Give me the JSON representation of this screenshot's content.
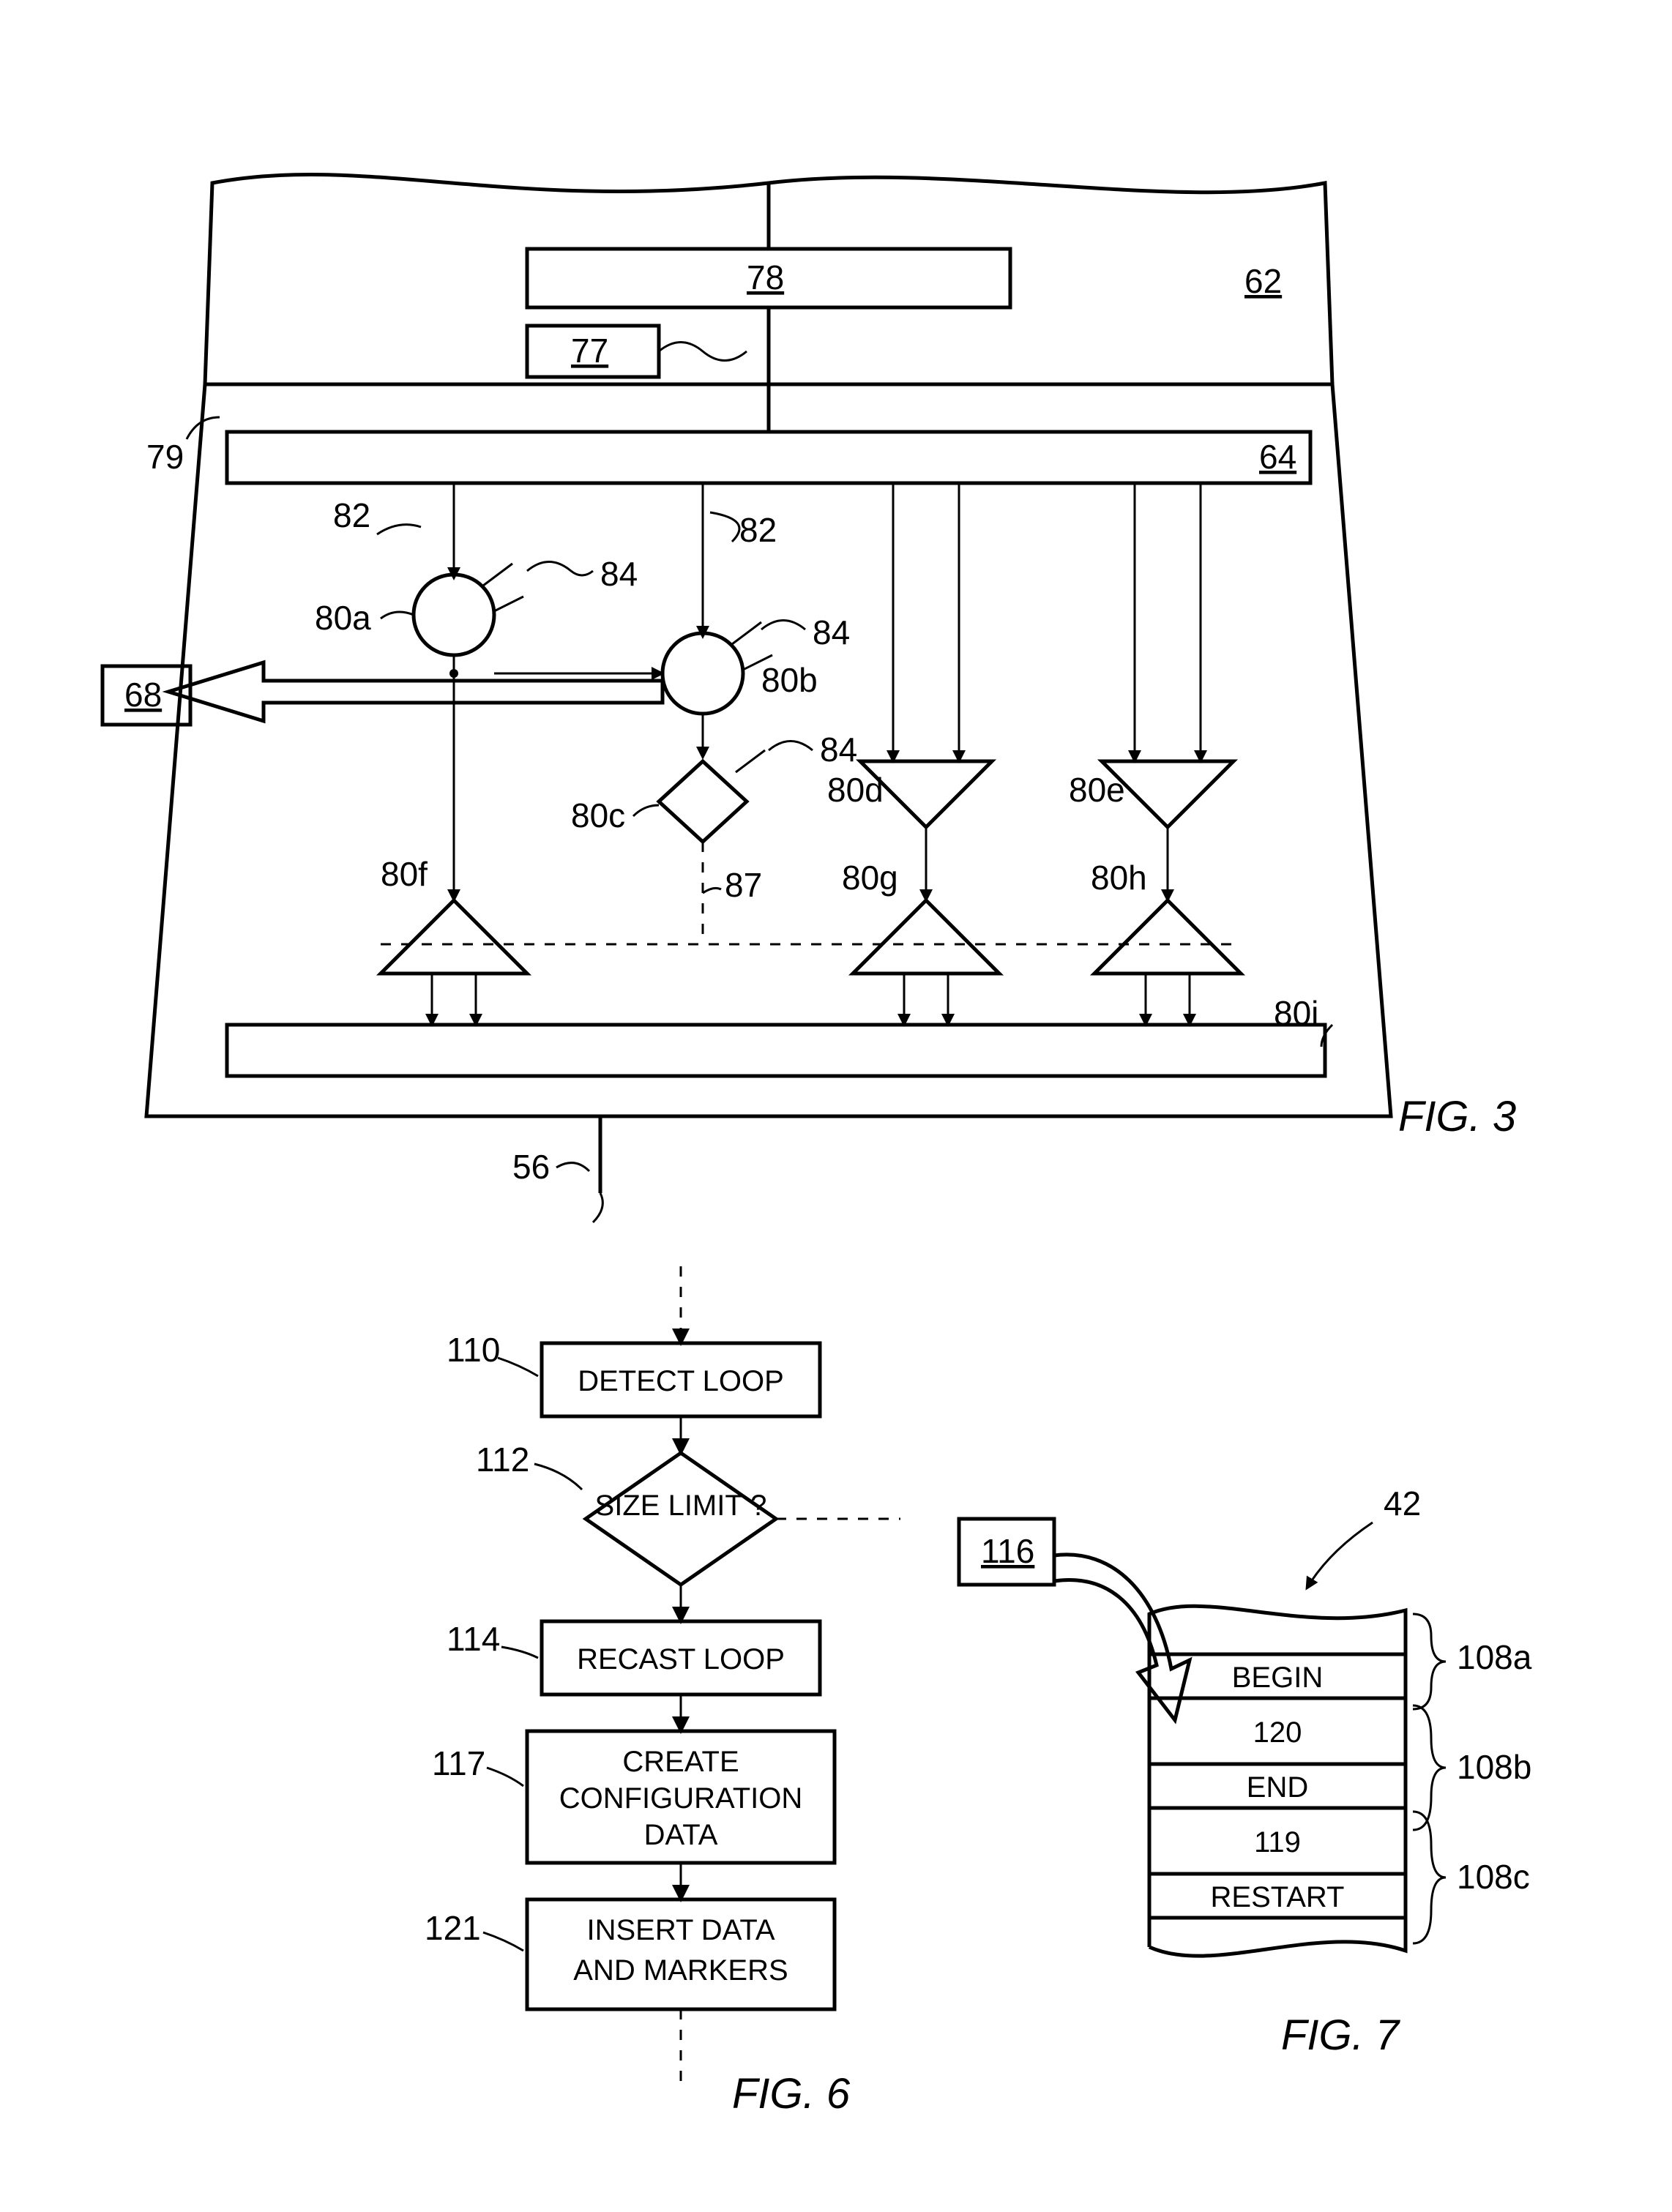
{
  "fig3": {
    "caption": "FIG. 3",
    "refs": {
      "r62": "62",
      "r64": "64",
      "r68": "68",
      "r77": "77",
      "r78": "78",
      "r79": "79",
      "r82a": "82",
      "r82b": "82",
      "r84a": "84",
      "r84b": "84",
      "r84c": "84",
      "r80a": "80a",
      "r80b": "80b",
      "r80c": "80c",
      "r80d": "80d",
      "r80e": "80e",
      "r80f": "80f",
      "r80g": "80g",
      "r80h": "80h",
      "r80i": "80i",
      "r87": "87",
      "r56": "56"
    }
  },
  "fig6": {
    "caption": "FIG. 6",
    "refs": {
      "r110": "110",
      "r112": "112",
      "r114": "114",
      "r117": "117",
      "r121": "121"
    },
    "boxes": {
      "b110": "DETECT LOOP",
      "b112": "SIZE LIMIT ?",
      "b114": "RECAST LOOP",
      "b117_l1": "CREATE",
      "b117_l2": "CONFIGURATION",
      "b117_l3": "DATA",
      "b121_l1": "INSERT DATA",
      "b121_l2": "AND MARKERS"
    }
  },
  "fig7": {
    "caption": "FIG. 7",
    "refs": {
      "r116": "116",
      "r42": "42",
      "r108a": "108a",
      "r108b": "108b",
      "r108c": "108c"
    },
    "rows": {
      "begin": "BEGIN",
      "r120": "120",
      "end": "END",
      "r119": "119",
      "restart": "RESTART"
    }
  }
}
